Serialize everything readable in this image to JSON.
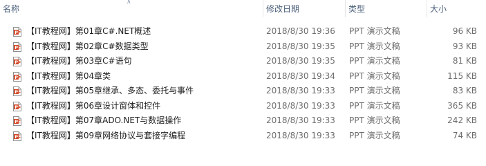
{
  "header": {
    "name_label": "名称",
    "date_label": "修改日期",
    "type_label": "类型",
    "size_label": "大小",
    "sort_icon": "sort-ascending-icon"
  },
  "files": [
    {
      "name": "【IT教程网】第01章C#.NET概述",
      "modified": "2018/8/30 19:36",
      "type": "PPT 演示文稿",
      "size": "96 KB"
    },
    {
      "name": "【IT教程网】第02章C#数据类型",
      "modified": "2018/8/30 19:35",
      "type": "PPT 演示文稿",
      "size": "93 KB"
    },
    {
      "name": "【IT教程网】第03章C#语句",
      "modified": "2018/8/30 19:35",
      "type": "PPT 演示文稿",
      "size": "81 KB"
    },
    {
      "name": "【IT教程网】第04章类",
      "modified": "2018/8/30 19:34",
      "type": "PPT 演示文稿",
      "size": "115 KB"
    },
    {
      "name": "【IT教程网】第05章继承、多态、委托与事件",
      "modified": "2018/8/30 19:33",
      "type": "PPT 演示文稿",
      "size": "83 KB"
    },
    {
      "name": "【IT教程网】第06章设计窗体和控件",
      "modified": "2018/8/30 19:33",
      "type": "PPT 演示文稿",
      "size": "365 KB"
    },
    {
      "name": "【IT教程网】第07章ADO.NET与数据操作",
      "modified": "2018/8/30 19:33",
      "type": "PPT 演示文稿",
      "size": "242 KB"
    },
    {
      "name": "【IT教程网】第09章网络协议与套接字编程",
      "modified": "2018/8/30 19:33",
      "type": "PPT 演示文稿",
      "size": "74 KB"
    }
  ],
  "icon": "ppt-file-icon",
  "colors": {
    "ppt_accent": "#d24726",
    "header_text": "#4c607a",
    "secondary_text": "#6d6d6d"
  }
}
